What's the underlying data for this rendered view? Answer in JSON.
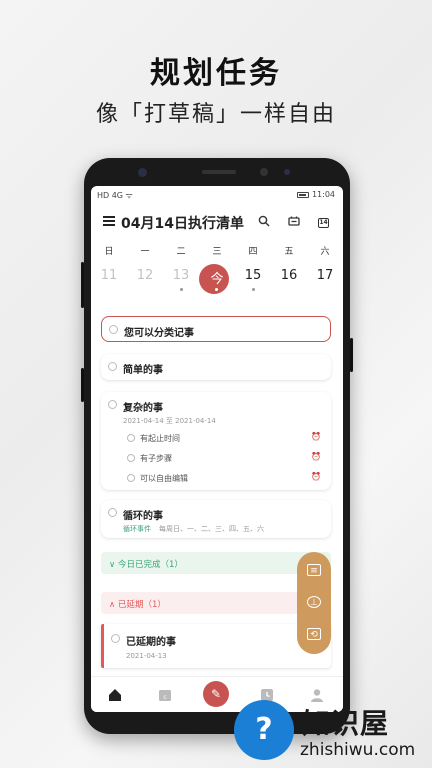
{
  "hero": {
    "title": "规划任务",
    "subtitle": "像「打草稿」一样自由"
  },
  "status": {
    "left": "HD 4G ᯤ",
    "time": "11:04"
  },
  "appbar": {
    "title": "04月14日执行清单",
    "cal_day": "14"
  },
  "calendar": {
    "weekdays": [
      "日",
      "一",
      "二",
      "三",
      "四",
      "五",
      "六"
    ],
    "dates": [
      "11",
      "12",
      "13",
      "今",
      "15",
      "16",
      "17"
    ],
    "today_index": 3
  },
  "tasks": {
    "hint": "您可以分类记事",
    "simple": "简单的事",
    "complex": {
      "title": "复杂的事",
      "range": "2021-04-14 至 2021-04-14",
      "subtasks": [
        "有起止时间",
        "有子步骤",
        "可以自由编辑"
      ]
    },
    "repeat": {
      "title": "循环的事",
      "tag": "循环事件",
      "schedule": "每周日、一、二、三、四、五、六"
    }
  },
  "sections": {
    "done": "今日已完成（1）",
    "late": "已延期（1）"
  },
  "late_task": {
    "title": "已延期的事",
    "date": "2021-04-13"
  },
  "colors": {
    "accent": "#c85452",
    "fab": "#cf9a5d",
    "done": "#3aa57a",
    "late": "#e05a5a"
  },
  "watermark": {
    "brand": "知识屋",
    "url": "zhishiwu.com"
  }
}
